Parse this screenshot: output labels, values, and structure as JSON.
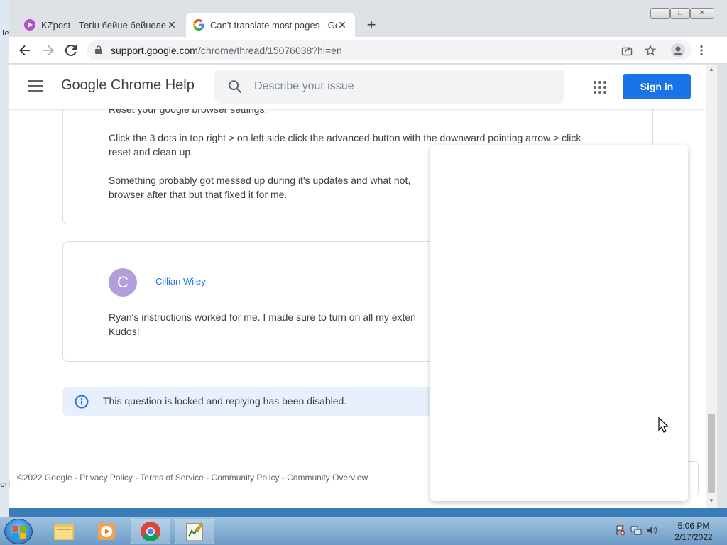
{
  "desktop_left": {
    "labels": [
      "ile",
      "i",
      "ori"
    ]
  },
  "window": {
    "tabs": [
      {
        "title": "KZpost - Тегін бейне бейнелерд",
        "favicon": "kzpost-play-icon",
        "active": false
      },
      {
        "title": "Can't translate most pages - Goo",
        "favicon": "google-g-icon",
        "active": true
      }
    ],
    "new_tab": "+",
    "controls": {
      "minimize": "—",
      "maximize": "□",
      "close": "✕"
    }
  },
  "toolbar": {
    "url_host": "support.google.com",
    "url_path": "/chrome/thread/15076038?hl=en"
  },
  "page": {
    "header": {
      "brand": "Google Chrome Help",
      "search_placeholder": "Describe your issue",
      "signin_label": "Sign in"
    },
    "reply1": {
      "line0": "Reset your google browser settings.",
      "para1": "Click the 3 dots in top right > on left side click the advanced button with the downward pointing arrow > click reset and clean up.",
      "para2": "Something probably got messed up during it's updates and what not, browser after that but that fixed it for me."
    },
    "reply2": {
      "avatar_letter": "C",
      "author": "Cillian Wiley",
      "text": "Ryan's instructions worked for me. I made sure to turn on all my exten Kudos!"
    },
    "notice": "This question is locked and replying has been disabled.",
    "footer": {
      "copyright": "©2022 Google",
      "links": [
        "Privacy Policy",
        "Terms of Service",
        "Community Policy",
        "Community Overview"
      ]
    },
    "accent_color": "#1a73e8"
  },
  "taskbar": {
    "clock_time": "5:06 PM",
    "clock_date": "2/17/2022"
  }
}
